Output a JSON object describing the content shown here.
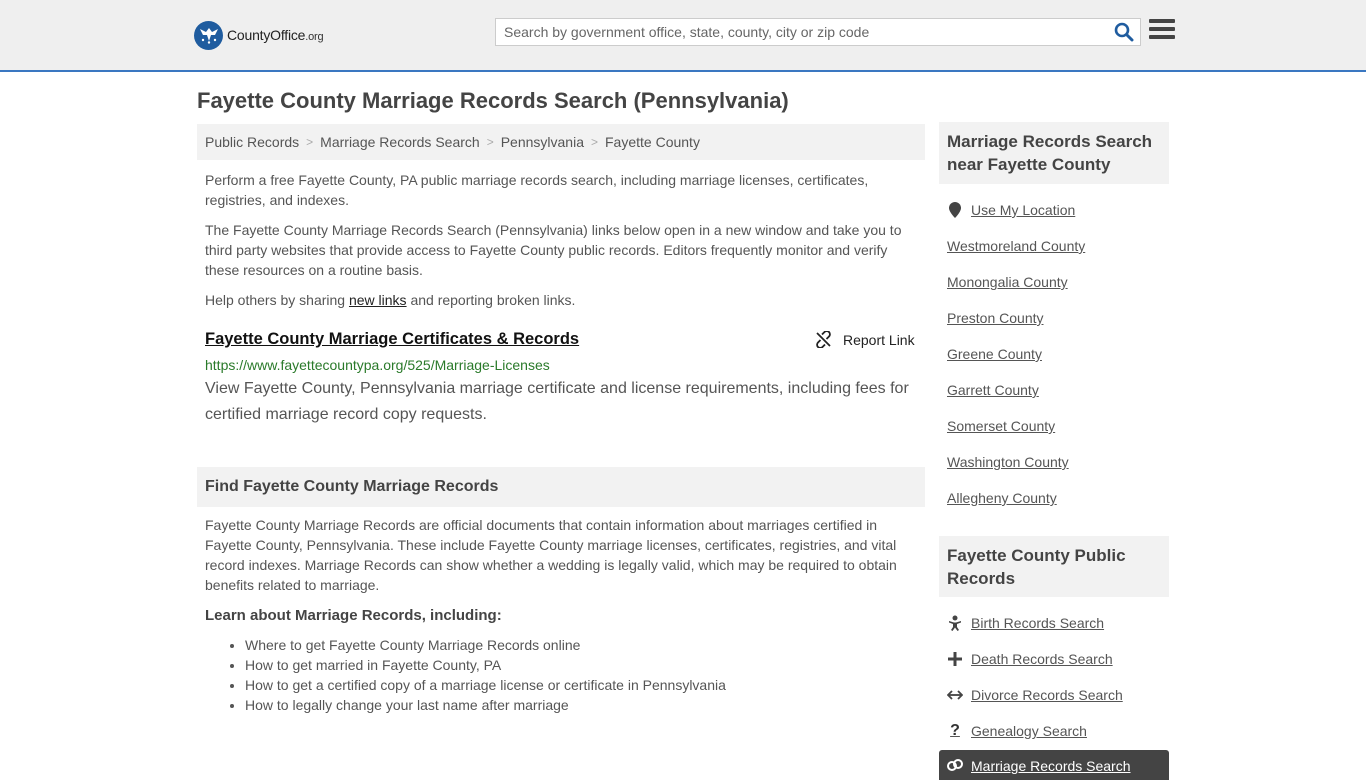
{
  "header": {
    "logo_main": "CountyOffice",
    "logo_suffix": ".org",
    "search_placeholder": "Search by government office, state, county, city or zip code"
  },
  "page_title": "Fayette County Marriage Records Search (Pennsylvania)",
  "breadcrumb": [
    "Public Records",
    "Marriage Records Search",
    "Pennsylvania",
    "Fayette County"
  ],
  "intro": {
    "p1": "Perform a free Fayette County, PA public marriage records search, including marriage licenses, certificates, registries, and indexes.",
    "p2": "The Fayette County Marriage Records Search (Pennsylvania) links below open in a new window and take you to third party websites that provide access to Fayette County public records. Editors frequently monitor and verify these resources on a routine basis.",
    "p3_before": "Help others by sharing ",
    "p3_link": "new links",
    "p3_after": " and reporting broken links."
  },
  "result": {
    "title": "Fayette County Marriage Certificates & Records",
    "report_label": "Report Link",
    "url": "https://www.fayettecountypa.org/525/Marriage-Licenses",
    "description": "View Fayette County, Pennsylvania marriage certificate and license requirements, including fees for certified marriage record copy requests."
  },
  "find_section": {
    "heading": "Find Fayette County Marriage Records",
    "body": "Fayette County Marriage Records are official documents that contain information about marriages certified in Fayette County, Pennsylvania. These include Fayette County marriage licenses, certificates, registries, and vital record indexes. Marriage Records can show whether a wedding is legally valid, which may be required to obtain benefits related to marriage.",
    "learn_heading": "Learn about Marriage Records, including:",
    "learn_items": [
      "Where to get Fayette County Marriage Records online",
      "How to get married in Fayette County, PA",
      "How to get a certified copy of a marriage license or certificate in Pennsylvania",
      "How to legally change your last name after marriage"
    ]
  },
  "sidebar": {
    "nearby_heading": "Marriage Records Search near Fayette County",
    "use_location": "Use My Location",
    "nearby": [
      "Westmoreland County",
      "Monongalia County",
      "Preston County",
      "Greene County",
      "Garrett County",
      "Somerset County",
      "Washington County",
      "Allegheny County"
    ],
    "public_heading": "Fayette County Public Records",
    "public_links": [
      {
        "label": "Birth Records Search",
        "icon": "baby-icon"
      },
      {
        "label": "Death Records Search",
        "icon": "cross-icon"
      },
      {
        "label": "Divorce Records Search",
        "icon": "split-arrows-icon"
      },
      {
        "label": "Genealogy Search",
        "icon": "question-icon"
      }
    ],
    "active_link": {
      "label": "Marriage Records Search",
      "icon": "rings-icon"
    }
  },
  "colors": {
    "accent": "#3a77c1",
    "url_green": "#2a7a2a",
    "panel_bg": "#f2f2f2"
  }
}
